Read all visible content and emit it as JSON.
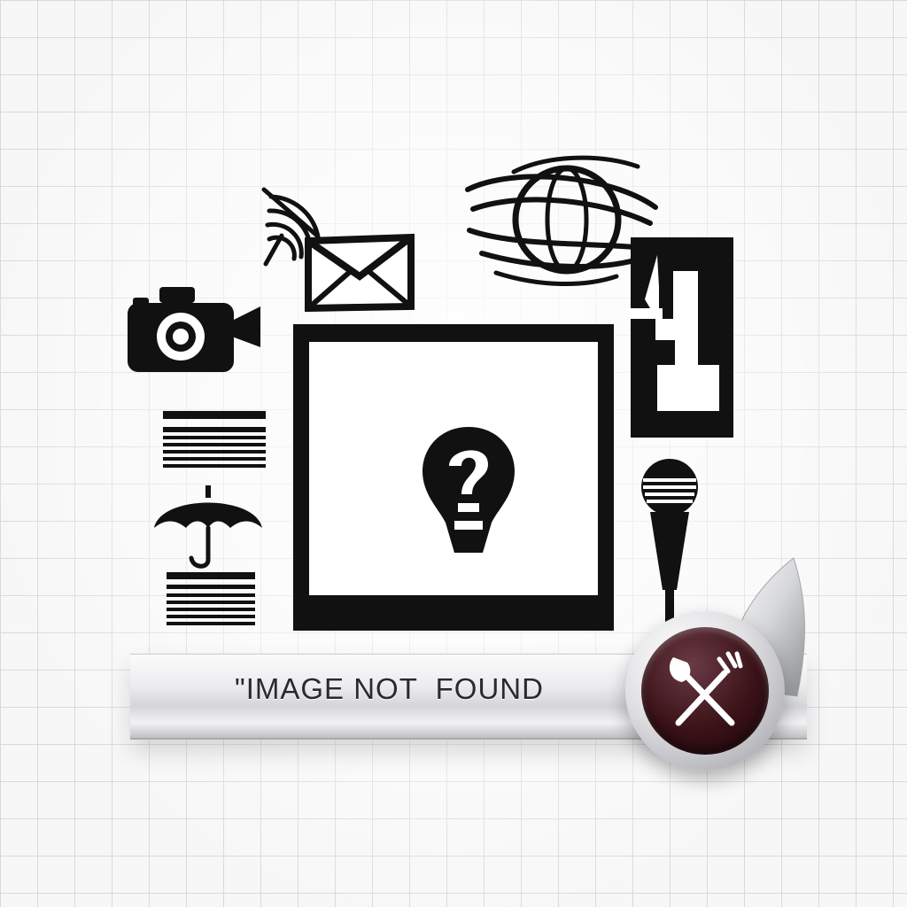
{
  "placeholder": {
    "status_text": "\"IMAGE NOT  FOUND"
  },
  "icons": {
    "camera": "camera-icon",
    "envelope": "envelope-icon",
    "signal": "wifi-signal-icon",
    "globe": "globe-icon",
    "number_tile": "number-four-icon",
    "text_block_top": "text-lines-icon",
    "umbrella": "umbrella-icon",
    "text_block_bottom": "text-lines-icon",
    "microphone": "microphone-icon",
    "question_bulb": "question-bulb-icon",
    "badge": "shovel-fork-icon"
  },
  "colors": {
    "icon_fill": "#111111",
    "badge_core": "#3a1218",
    "grid_line": "#d8d9dc"
  }
}
